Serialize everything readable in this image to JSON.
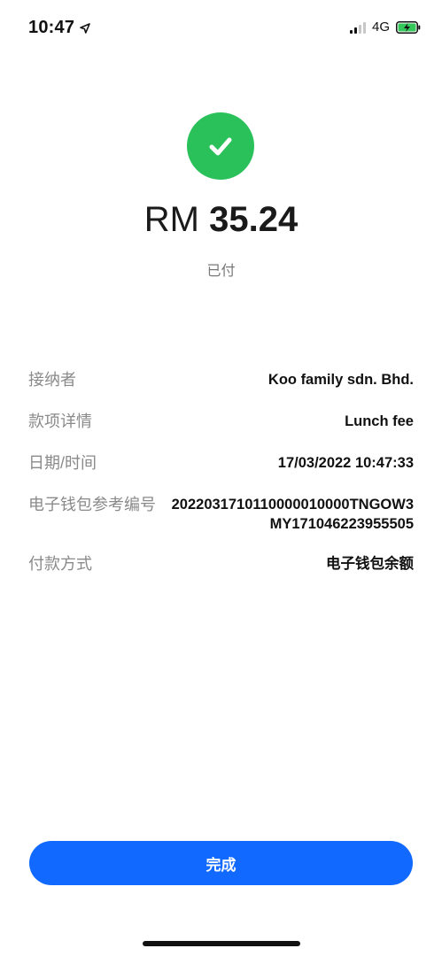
{
  "status_bar": {
    "time": "10:47",
    "network": "4G",
    "location_icon": "location-arrow-icon",
    "signal_icon": "signal-icon",
    "battery_icon": "battery-charging-icon"
  },
  "receipt": {
    "success_icon": "check-circle-icon",
    "success_color": "#2bc15a",
    "currency": "RM",
    "amount": "35.24",
    "status": "已付"
  },
  "details": [
    {
      "label": "接纳者",
      "value": "Koo family sdn. Bhd."
    },
    {
      "label": "款项详情",
      "value": "Lunch fee"
    },
    {
      "label": "日期/时间",
      "value": "17/03/2022 10:47:33"
    },
    {
      "label": "电子钱包参考编号",
      "value": "20220317101100000100​00TNGOW3MY171046223955505"
    },
    {
      "label": "付款方式",
      "value": "电子钱包余额"
    }
  ],
  "actions": {
    "done_label": "完成",
    "button_color": "#1169ff"
  }
}
